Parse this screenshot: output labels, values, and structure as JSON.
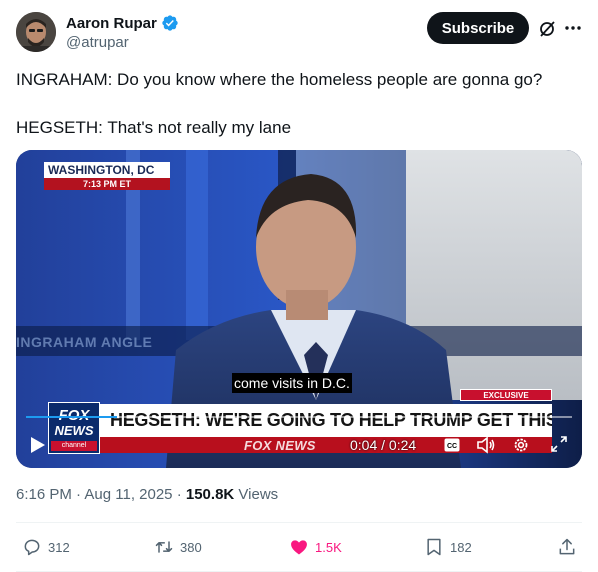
{
  "author": {
    "name": "Aaron Rupar",
    "handle": "@atrupar",
    "verified": true
  },
  "header": {
    "subscribe_label": "Subscribe",
    "grok_icon": "grok-slash-icon",
    "more_icon": "more-dots-icon"
  },
  "tweet": {
    "line1": "INGRAHAM: Do you know where the homeless people are gonna go?",
    "line2": "HEGSETH: That's not really my lane"
  },
  "video": {
    "dateline_location": "WASHINGTON, DC",
    "dateline_time": "7:13 PM ET",
    "wall_text": "INGRAHAM ANGLE",
    "caption": "come visits in D.C.",
    "exclusive_label": "EXCLUSIVE",
    "headline": "HEGSETH: WE'RE GOING TO HELP TRUMP GET THIS DONE",
    "fox_logo_line1": "FOX",
    "fox_logo_line2": "NEWS",
    "fox_logo_line3": "channel",
    "watermark": "FOX NEWS",
    "timecode": "0:04 / 0:24",
    "progress_fraction": 0.167,
    "progress_color": "#1d9bf0"
  },
  "meta": {
    "time": "6:16 PM",
    "date": "Aug 11, 2025",
    "views_count": "150.8K",
    "views_label": "Views"
  },
  "actions": {
    "replies": "312",
    "reposts": "380",
    "likes": "1.5K",
    "bookmarks": "182",
    "like_color": "#f91880"
  }
}
